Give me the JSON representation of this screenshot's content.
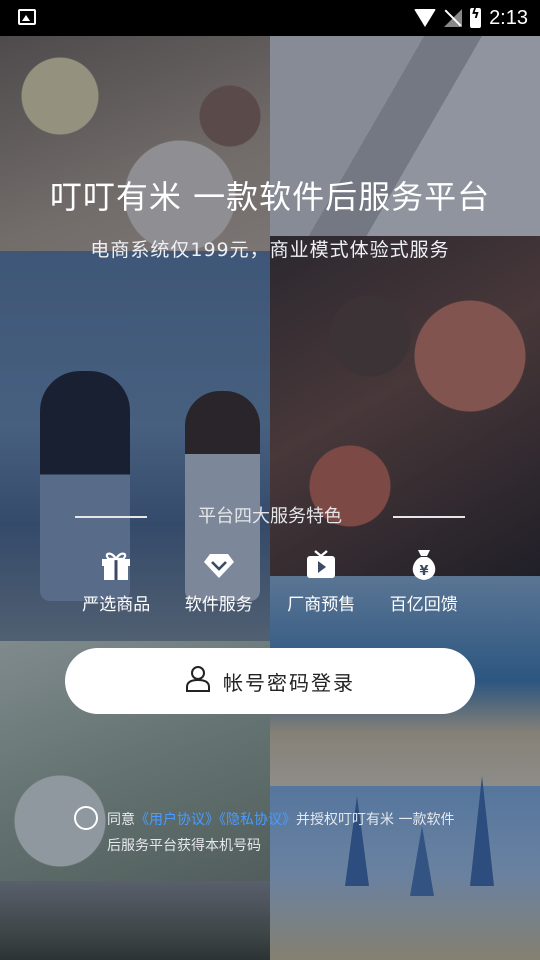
{
  "status_bar": {
    "time": "2:13",
    "icons": [
      "image-icon",
      "wifi-icon",
      "no-signal-icon",
      "battery-charging-icon"
    ]
  },
  "header": {
    "title": "叮叮有米 一款软件后服务平台",
    "subtitle": "电商系统仅199元，商业模式体验式服务"
  },
  "features": {
    "title": "平台四大服务特色",
    "items": [
      {
        "label": "严选商品",
        "icon": "gift-icon"
      },
      {
        "label": "软件服务",
        "icon": "diamond-icon"
      },
      {
        "label": "厂商预售",
        "icon": "tv-play-icon"
      },
      {
        "label": "百亿回馈",
        "icon": "money-bag-icon"
      }
    ]
  },
  "login": {
    "button_label": "帐号密码登录",
    "icon": "user-icon"
  },
  "agreement": {
    "prefix": "同意",
    "user_agreement": "《用户协议》",
    "privacy_policy": "《隐私协议》",
    "suffix": "并授权叮叮有米 一款软件后服务平台获得本机号码"
  },
  "colors": {
    "link": "#4a9bff",
    "button_bg": "#ffffff",
    "overlay": "rgba(20,30,55,0.42)"
  }
}
